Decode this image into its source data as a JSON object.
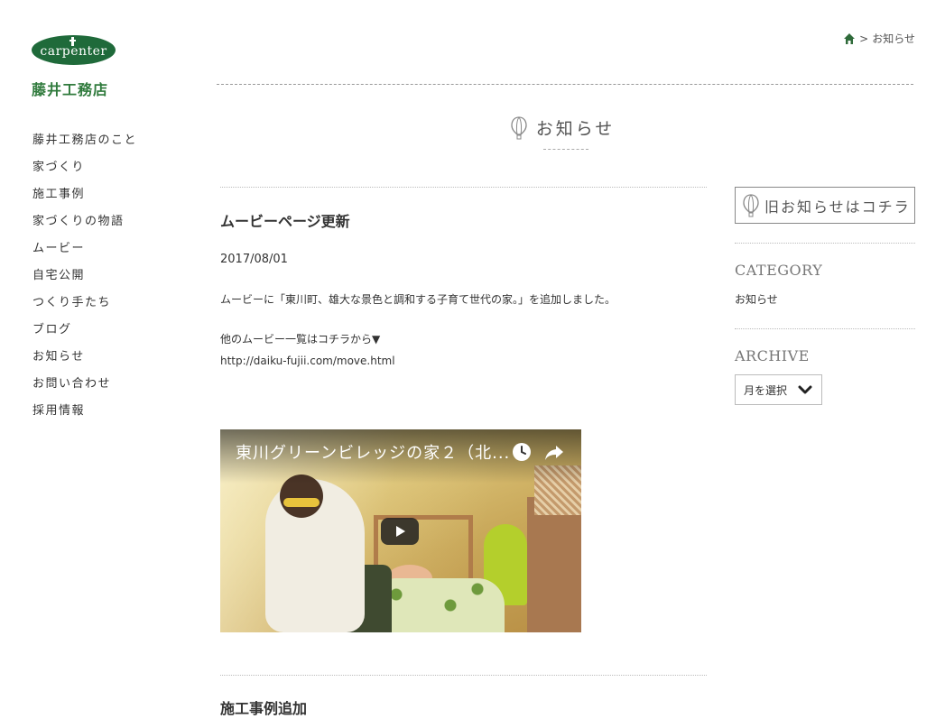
{
  "brand": {
    "logo_text": "carpenter",
    "company_name": "藤井工務店"
  },
  "nav": {
    "items": [
      {
        "label": "藤井工務店のこと"
      },
      {
        "label": "家づくり"
      },
      {
        "label": "施工事例"
      },
      {
        "label": "家づくりの物語"
      },
      {
        "label": "ムービー"
      },
      {
        "label": "自宅公開"
      },
      {
        "label": "つくり手たち"
      },
      {
        "label": "ブログ"
      },
      {
        "label": "お知らせ"
      },
      {
        "label": "お問い合わせ"
      },
      {
        "label": "採用情報"
      }
    ]
  },
  "breadcrumb": {
    "separator": ">",
    "current": "お知らせ"
  },
  "page": {
    "title": "お知らせ"
  },
  "posts": [
    {
      "title": "ムービーページ更新",
      "date": "2017/08/01",
      "body_line1": "ムービーに「東川町、雄大な景色と調和する子育て世代の家。」を追加しました。",
      "body_line2": "他のムービー一覧はコチラから▼",
      "link": "http://daiku-fujii.com/move.html",
      "video_title": "東川グリーンビレッジの家２（北..."
    },
    {
      "title": "施工事例追加"
    }
  ],
  "sidebar": {
    "old_news_label": "旧お知らせはコチラ",
    "category_heading": "CATEGORY",
    "category_item": "お知らせ",
    "archive_heading": "ARCHIVE",
    "archive_select": "月を選択"
  },
  "colors": {
    "brand_green": "#1f6a3a",
    "company_green": "#2f7a3c"
  }
}
